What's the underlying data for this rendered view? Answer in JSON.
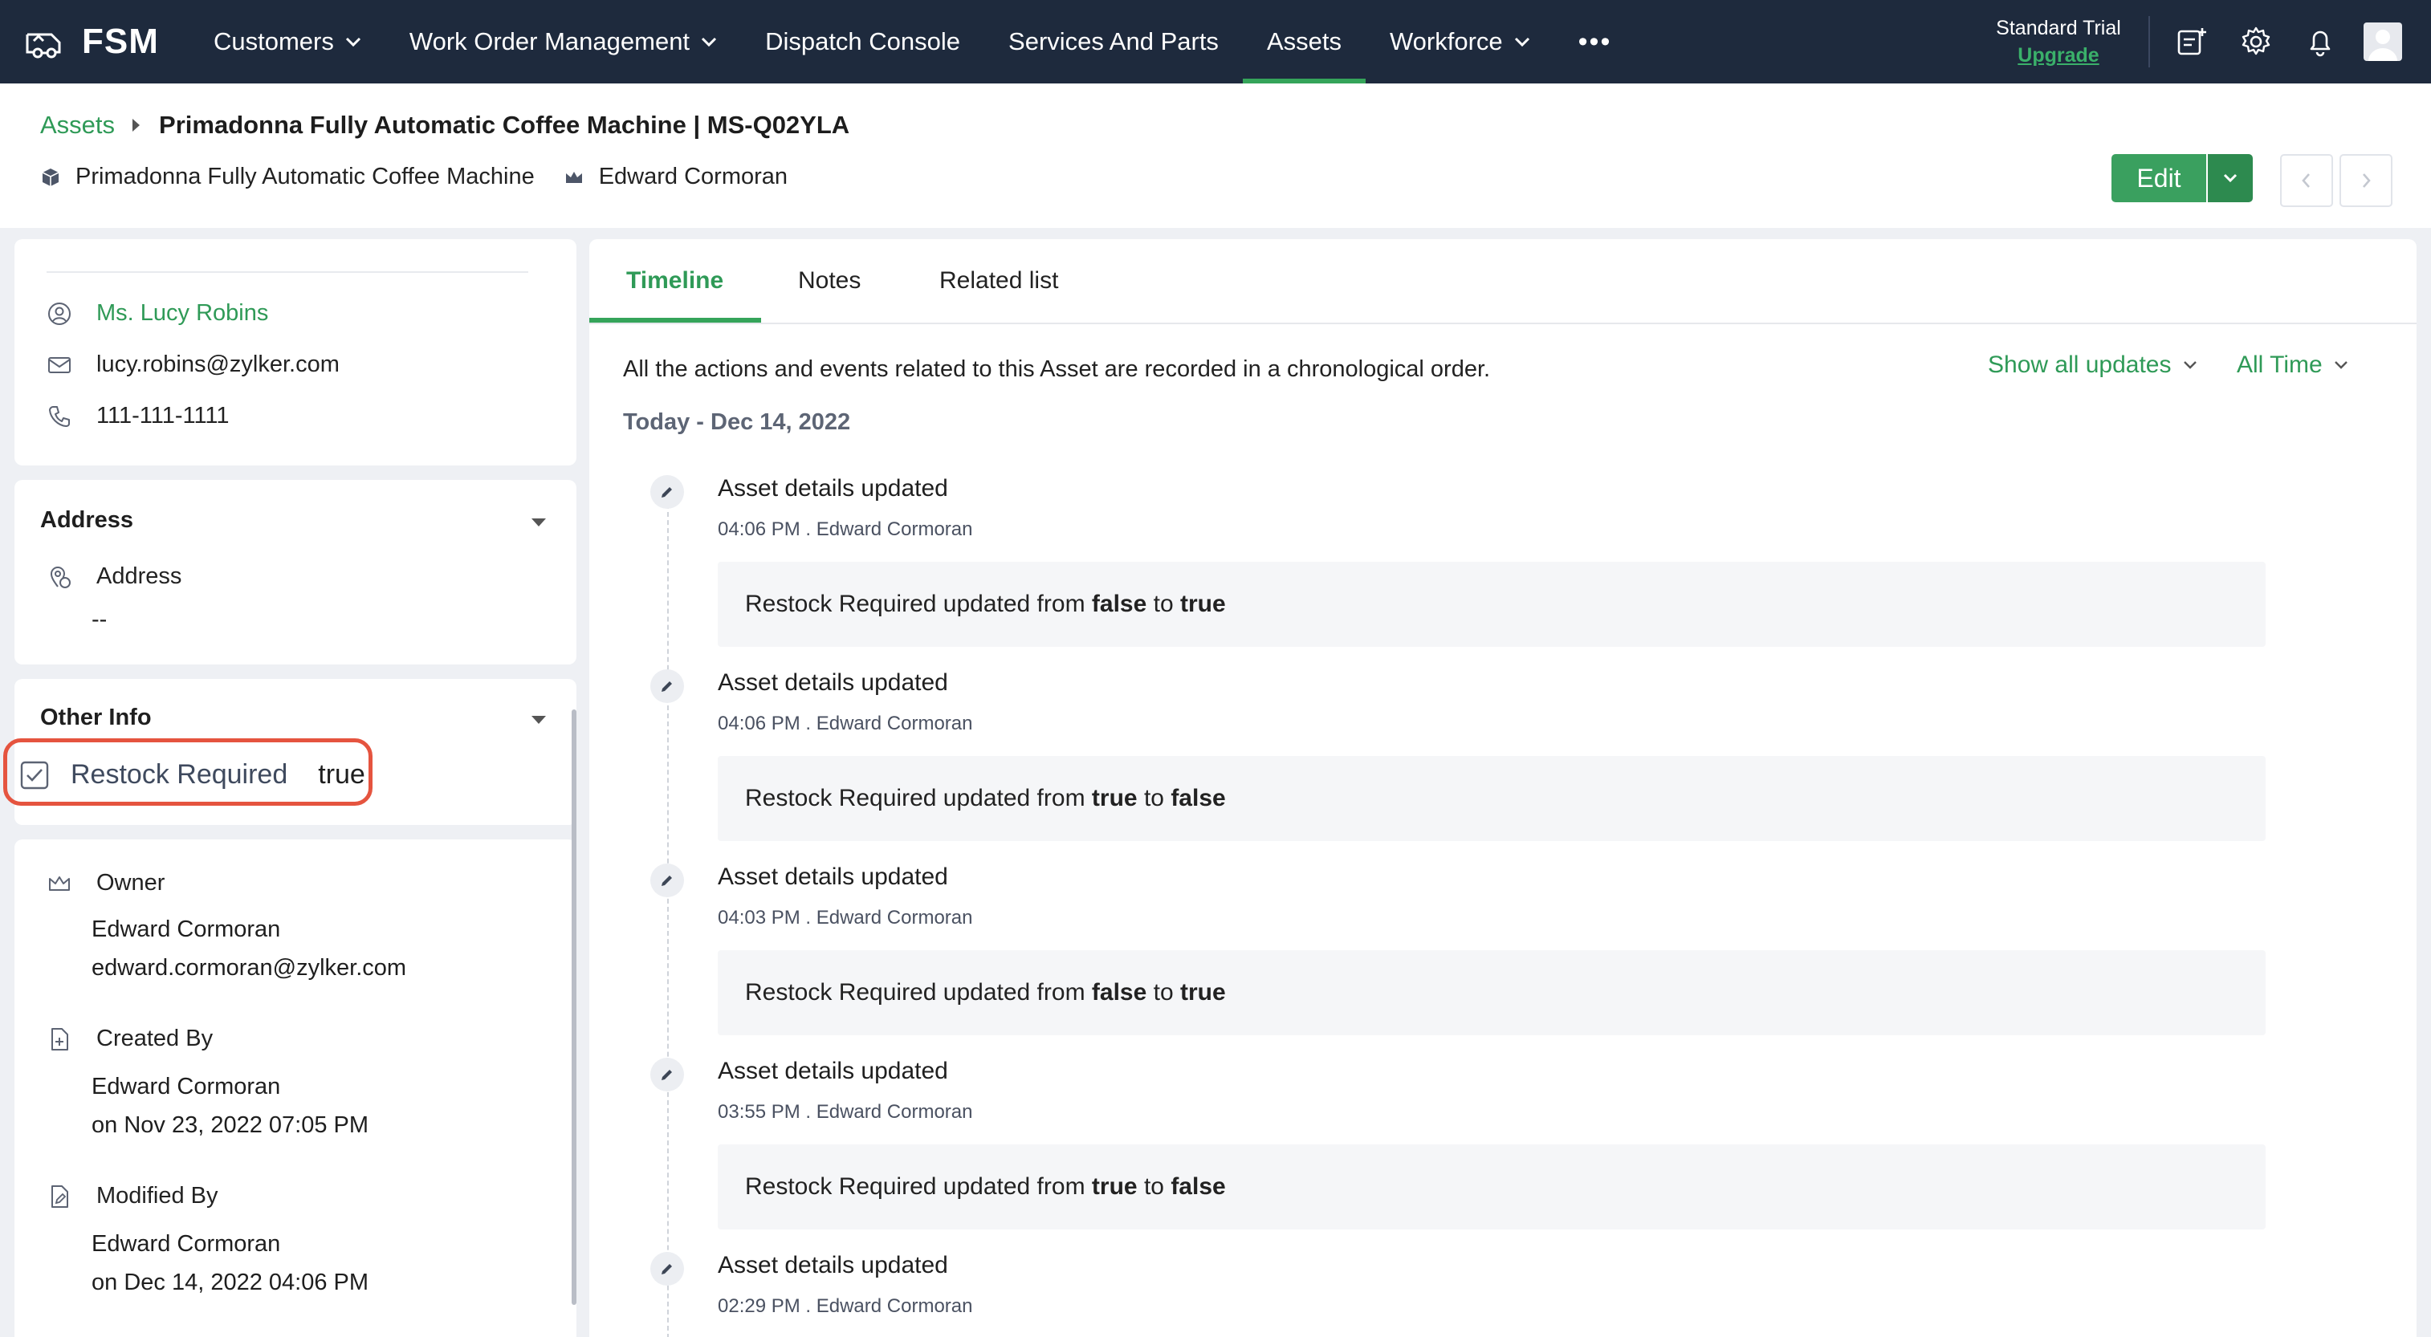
{
  "nav": {
    "brand": "FSM",
    "items": [
      {
        "label": "Customers",
        "dropdown": true
      },
      {
        "label": "Work Order Management",
        "dropdown": true
      },
      {
        "label": "Dispatch Console",
        "dropdown": false
      },
      {
        "label": "Services And Parts",
        "dropdown": false
      },
      {
        "label": "Assets",
        "dropdown": false,
        "active": true
      },
      {
        "label": "Workforce",
        "dropdown": true
      }
    ],
    "more": "•••",
    "trial_label": "Standard Trial",
    "upgrade_label": "Upgrade",
    "icons": [
      "add-note-icon",
      "gear-icon",
      "bell-icon",
      "avatar"
    ]
  },
  "header": {
    "breadcrumb_root": "Assets",
    "breadcrumb_current": "Primadonna Fully Automatic Coffee Machine | MS-Q02YLA",
    "product_name": "Primadonna Fully Automatic Coffee Machine",
    "owner_name": "Edward Cormoran",
    "edit_label": "Edit"
  },
  "contact": {
    "name": "Ms. Lucy Robins",
    "email": "lucy.robins@zylker.com",
    "phone": "111-111-1111"
  },
  "address_section": {
    "title": "Address",
    "field_label": "Address",
    "field_value": "--"
  },
  "other_info": {
    "title": "Other Info",
    "restock_label": "Restock Required",
    "restock_value": "true"
  },
  "record_info": {
    "owner_label": "Owner",
    "owner_name": "Edward Cormoran",
    "owner_email": "edward.cormoran@zylker.com",
    "created_label": "Created By",
    "created_name": "Edward Cormoran",
    "created_on": "on Nov 23, 2022 07:05 PM",
    "modified_label": "Modified By",
    "modified_name": "Edward Cormoran",
    "modified_on": "on Dec 14, 2022 04:06 PM"
  },
  "tabs": [
    "Timeline",
    "Notes",
    "Related list"
  ],
  "timeline": {
    "description": "All the actions and events related to this Asset are recorded in a chronological order.",
    "filter_updates": "Show all updates",
    "filter_time": "All Time",
    "date_heading": "Today - Dec 14, 2022",
    "entries": [
      {
        "title": "Asset details updated",
        "meta": "04:06 PM . Edward Cormoran",
        "prefix": "Restock Required updated from",
        "from": "false",
        "to_word": "to",
        "to": "true"
      },
      {
        "title": "Asset details updated",
        "meta": "04:06 PM . Edward Cormoran",
        "prefix": "Restock Required updated from",
        "from": "true",
        "to_word": "to",
        "to": "false"
      },
      {
        "title": "Asset details updated",
        "meta": "04:03 PM . Edward Cormoran",
        "prefix": "Restock Required updated from",
        "from": "false",
        "to_word": "to",
        "to": "true"
      },
      {
        "title": "Asset details updated",
        "meta": "03:55 PM . Edward Cormoran",
        "prefix": "Restock Required updated from",
        "from": "true",
        "to_word": "to",
        "to": "false"
      },
      {
        "title": "Asset details updated",
        "meta": "02:29 PM . Edward Cormoran"
      }
    ]
  },
  "colors": {
    "nav_bg": "#1e2a3d",
    "accent_green": "#35a45a",
    "highlight_red": "#e5543f"
  }
}
